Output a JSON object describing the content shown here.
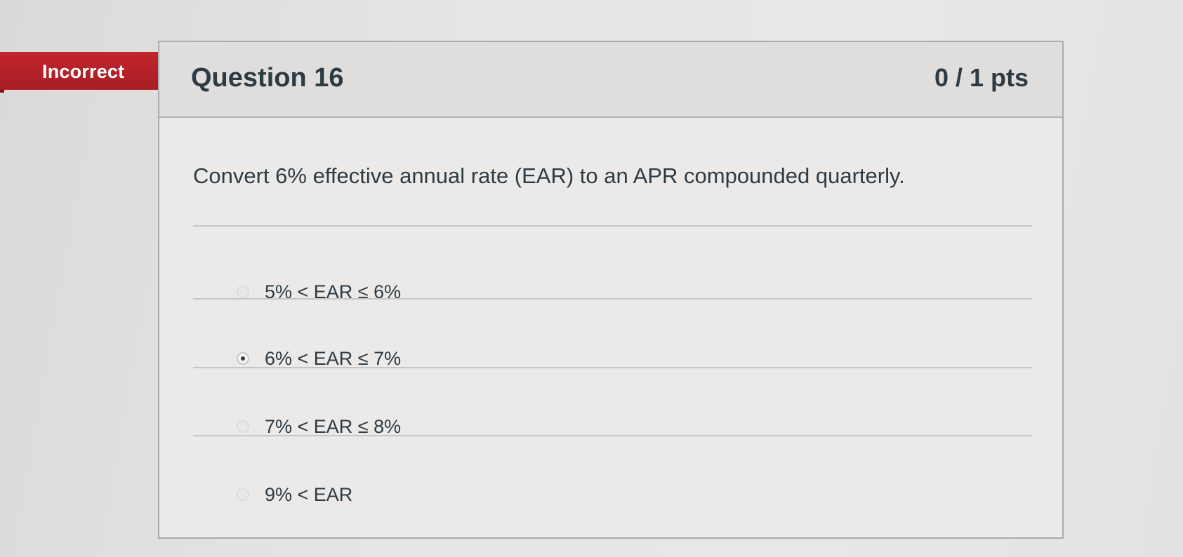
{
  "status": {
    "label": "Incorrect",
    "color": "#b5232a"
  },
  "question": {
    "title": "Question 16",
    "points": "0 / 1 pts",
    "text": "Convert 6% effective annual rate (EAR) to an APR compounded quarterly."
  },
  "answers": [
    {
      "label": "5% < EAR ≤ 6%",
      "selected": false,
      "icon": "radio-icon"
    },
    {
      "label": "6% < EAR ≤ 7%",
      "selected": true,
      "icon": "radio-selected-icon"
    },
    {
      "label": "7% < EAR ≤ 8%",
      "selected": false,
      "icon": "radio-icon"
    },
    {
      "label": "9% < EAR",
      "selected": false,
      "icon": "radio-icon"
    }
  ]
}
